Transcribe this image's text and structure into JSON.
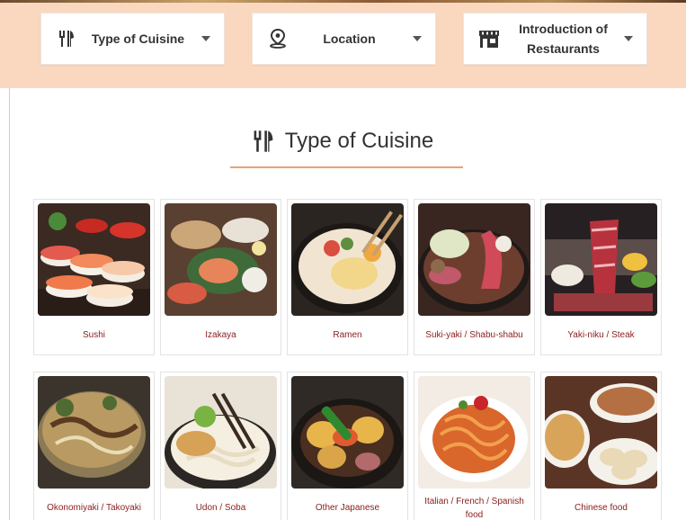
{
  "header": {
    "nav": [
      {
        "label": "Type of Cuisine",
        "icon": "utensils-icon"
      },
      {
        "label": "Location",
        "icon": "map-pin-icon"
      },
      {
        "label": "Introduction of Restaurants",
        "icon": "store-icon"
      }
    ],
    "background": "#fad8c0"
  },
  "section": {
    "title": "Type of Cuisine",
    "icon": "utensils-icon",
    "accent": "#eba270"
  },
  "cuisines": [
    {
      "label": "Sushi"
    },
    {
      "label": "Izakaya"
    },
    {
      "label": "Ramen"
    },
    {
      "label": "Suki-yaki / Shabu-shabu"
    },
    {
      "label": "Yaki-niku / Steak"
    },
    {
      "label": "Okonomiyaki / Takoyaki"
    },
    {
      "label": "Udon / Soba"
    },
    {
      "label": "Other Japanese"
    },
    {
      "label": "Italian / French / Spanish food"
    },
    {
      "label": "Chinese food"
    }
  ],
  "colors": {
    "card_label": "#8b1c1c",
    "text": "#333333"
  }
}
